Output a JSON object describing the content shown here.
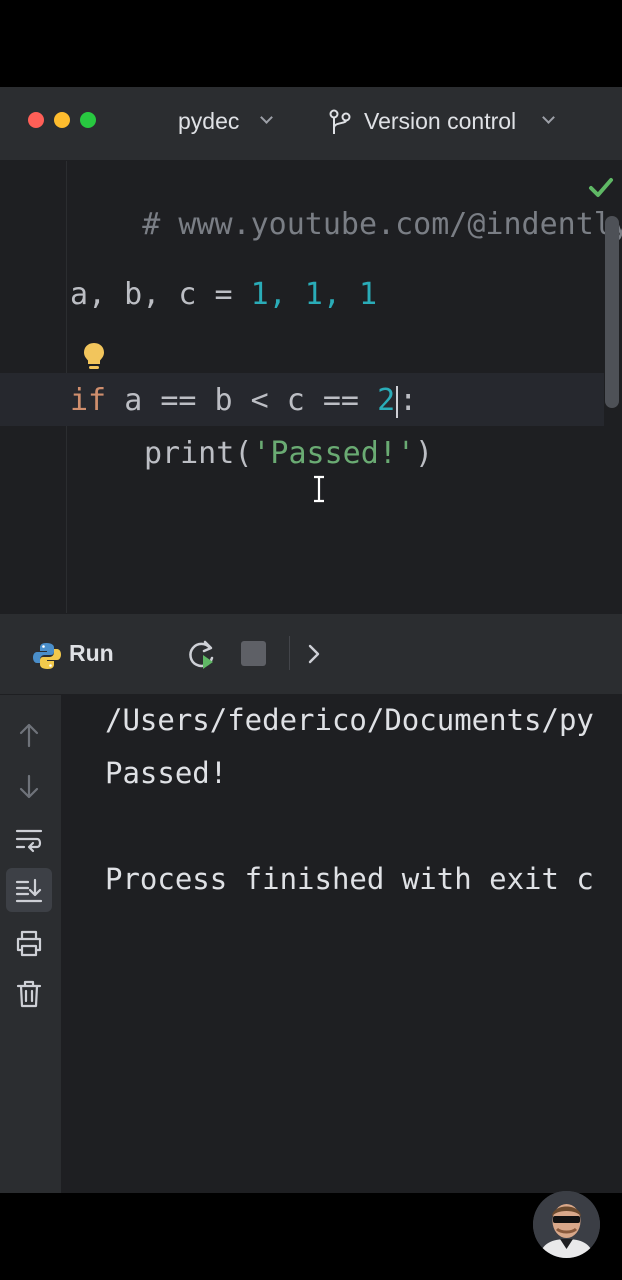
{
  "window": {
    "project_name": "pydec",
    "version_control_label": "Version control"
  },
  "editor": {
    "line1": "# www.youtube.com/@indently",
    "line3": {
      "vars": "a, b, c",
      "eq": "=",
      "vals": "1, 1, 1"
    },
    "line5": {
      "kw": "if",
      "expr_a": "a",
      "op1": "==",
      "expr_b": "b",
      "op2": "<",
      "expr_c": "c",
      "op3": "==",
      "num": "2",
      "colon": ":"
    },
    "line6": {
      "fn": "print",
      "open": "(",
      "str": "'Passed!'",
      "close": ")"
    }
  },
  "run_panel": {
    "title": "Run",
    "icons": [
      "python-icon",
      "rerun-icon",
      "stop-icon",
      "more-icon"
    ]
  },
  "console": {
    "lines": [
      "/Users/federico/Documents/py",
      "Passed!",
      "",
      "Process finished with exit c"
    ]
  },
  "sidebar_icons": [
    "arrow-up-icon",
    "arrow-down-icon",
    "soft-wrap-icon",
    "scroll-to-end-icon",
    "print-icon",
    "trash-icon"
  ],
  "colors": {
    "keyword": "#cf8e6d",
    "number": "#2aacb8",
    "string": "#6aab73",
    "comment": "#7a7e85"
  }
}
